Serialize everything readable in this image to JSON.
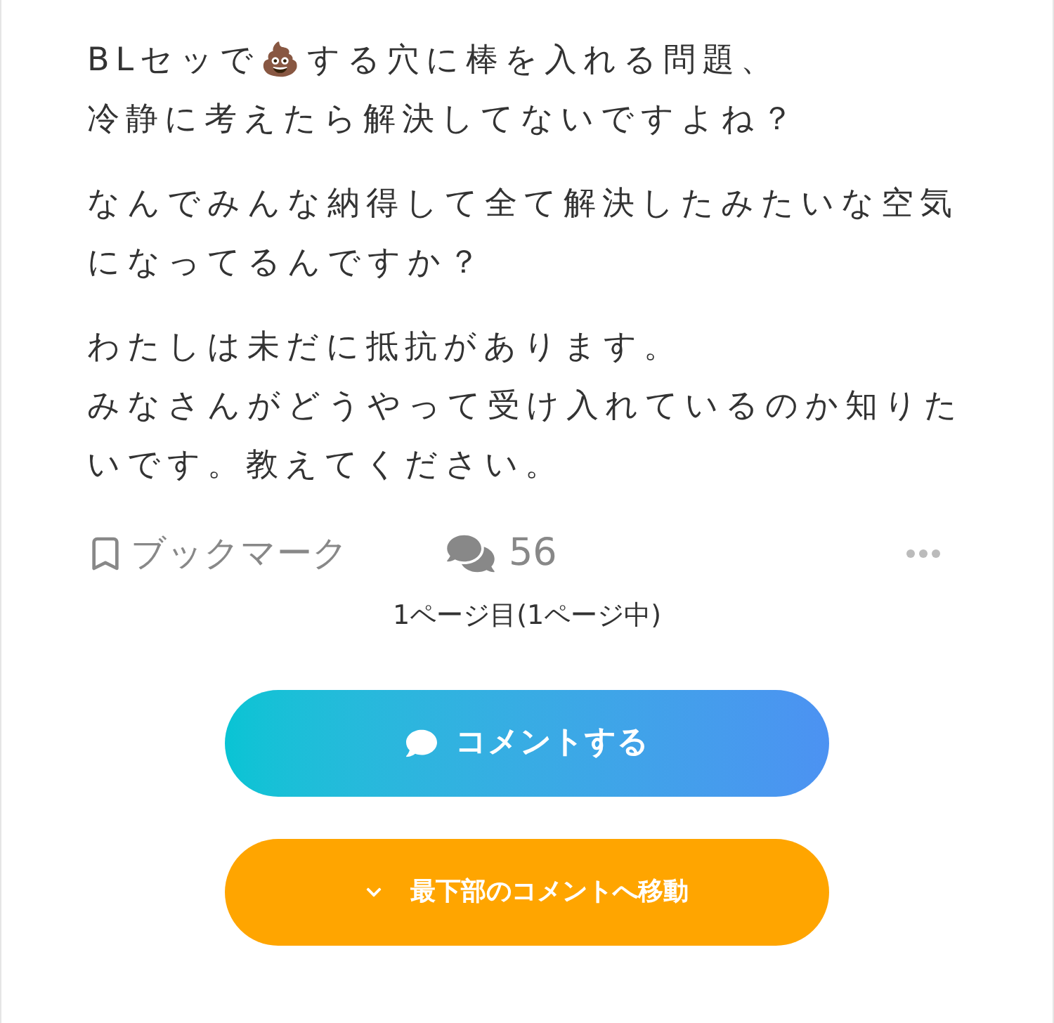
{
  "post": {
    "paragraphs": [
      [
        "BLセッで💩する穴に棒を入れる問題、",
        "冷静に考えたら解決してないですよね？"
      ],
      [
        "なんでみんな納得して全て解決したみたいな空気",
        "になってるんですか？"
      ],
      [
        "わたしは未だに抵抗があります。",
        "みなさんがどうやって受け入れているのか知りた",
        "いです。教えてください。"
      ]
    ]
  },
  "actions": {
    "bookmark": "ブックマーク",
    "comment_count": "56"
  },
  "pagination": "1ページ目(1ページ中)",
  "buttons": [
    {
      "kind": "comment",
      "label": "コメントする"
    },
    {
      "kind": "jump",
      "label": "最下部のコメントへ移動"
    }
  ]
}
